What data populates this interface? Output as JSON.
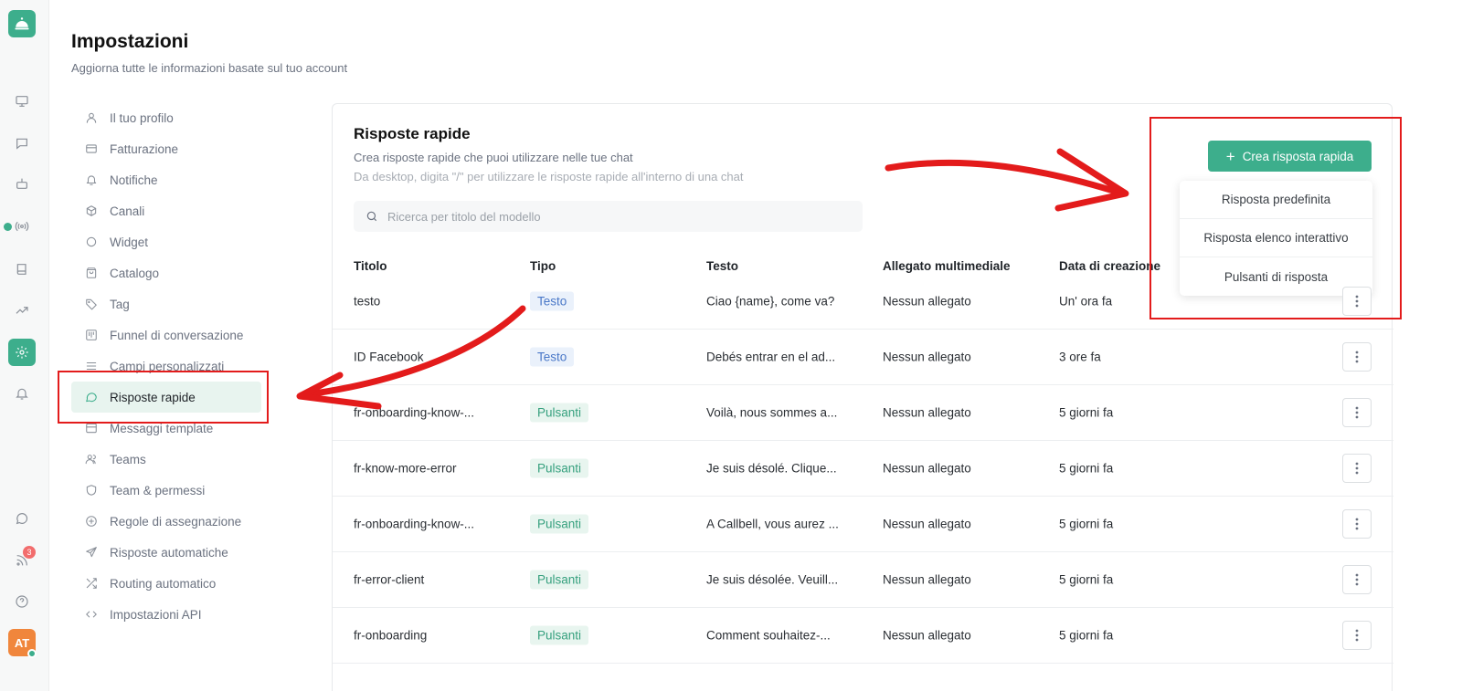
{
  "colors": {
    "accent": "#3dae8c",
    "annotation": "#e31b1b",
    "badge": "#f26d6d",
    "avatar": "#f0863c"
  },
  "rail": {
    "icons": [
      "bell-concierge-icon",
      "monitor-icon",
      "chat-icon",
      "robot-icon",
      "broadcast-icon",
      "book-icon",
      "trending-icon",
      "settings-icon",
      "bell-icon",
      "whatsapp-icon",
      "rss-icon",
      "help-icon"
    ],
    "active": "settings-icon",
    "badge_count": "3",
    "avatar_initials": "AT"
  },
  "header": {
    "title": "Impostazioni",
    "subtitle": "Aggiorna tutte le informazioni basate sul tuo account"
  },
  "nav": {
    "items": [
      {
        "label": "Il tuo profilo",
        "icon": "user-icon"
      },
      {
        "label": "Fatturazione",
        "icon": "card-icon"
      },
      {
        "label": "Notifiche",
        "icon": "bell-icon"
      },
      {
        "label": "Canali",
        "icon": "cube-icon"
      },
      {
        "label": "Widget",
        "icon": "circle-icon"
      },
      {
        "label": "Catalogo",
        "icon": "bag-icon"
      },
      {
        "label": "Tag",
        "icon": "tag-icon"
      },
      {
        "label": "Funnel di conversazione",
        "icon": "kanban-icon"
      },
      {
        "label": "Campi personalizzati",
        "icon": "list-icon"
      },
      {
        "label": "Risposte rapide",
        "icon": "message-icon",
        "active": true
      },
      {
        "label": "Messaggi template",
        "icon": "template-icon"
      },
      {
        "label": "Teams",
        "icon": "users-icon"
      },
      {
        "label": "Team & permessi",
        "icon": "shield-icon"
      },
      {
        "label": "Regole di assegnazione",
        "icon": "plus-circle-icon"
      },
      {
        "label": "Risposte automatiche",
        "icon": "send-icon"
      },
      {
        "label": "Routing automatico",
        "icon": "shuffle-icon"
      },
      {
        "label": "Impostazioni API",
        "icon": "code-icon"
      }
    ]
  },
  "panel": {
    "title": "Risposte rapide",
    "description": "Crea risposte rapide che puoi utilizzare nelle tue chat",
    "hint": "Da desktop, digita \"/\" per utilizzare le risposte rapide all'interno di una chat",
    "search_placeholder": "Ricerca per titolo del modello",
    "create_button": "Crea risposta rapida",
    "dropdown": [
      "Risposta predefinita",
      "Risposta elenco interattivo",
      "Pulsanti di risposta"
    ]
  },
  "table": {
    "headers": [
      "Titolo",
      "Tipo",
      "Testo",
      "Allegato multimediale",
      "Data di creazione"
    ],
    "rows": [
      {
        "title": "testo",
        "type": "Testo",
        "kind": "testo",
        "text": "Ciao {name}, come va?",
        "media": "Nessun allegato",
        "date": "Un' ora fa"
      },
      {
        "title": "ID Facebook",
        "type": "Testo",
        "kind": "testo",
        "text": "Debés entrar en el ad...",
        "media": "Nessun allegato",
        "date": "3 ore fa"
      },
      {
        "title": "fr-onboarding-know-...",
        "type": "Pulsanti",
        "kind": "pulsanti",
        "text": "Voilà, nous sommes a...",
        "media": "Nessun allegato",
        "date": "5 giorni fa"
      },
      {
        "title": "fr-know-more-error",
        "type": "Pulsanti",
        "kind": "pulsanti",
        "text": "Je suis désolé. Clique...",
        "media": "Nessun allegato",
        "date": "5 giorni fa"
      },
      {
        "title": "fr-onboarding-know-...",
        "type": "Pulsanti",
        "kind": "pulsanti",
        "text": "A Callbell, vous aurez ...",
        "media": "Nessun allegato",
        "date": "5 giorni fa"
      },
      {
        "title": "fr-error-client",
        "type": "Pulsanti",
        "kind": "pulsanti",
        "text": "Je suis désolée. Veuill...",
        "media": "Nessun allegato",
        "date": "5 giorni fa"
      },
      {
        "title": "fr-onboarding",
        "type": "Pulsanti",
        "kind": "pulsanti",
        "text": "Comment souhaitez-...",
        "media": "Nessun allegato",
        "date": "5 giorni fa"
      }
    ]
  }
}
